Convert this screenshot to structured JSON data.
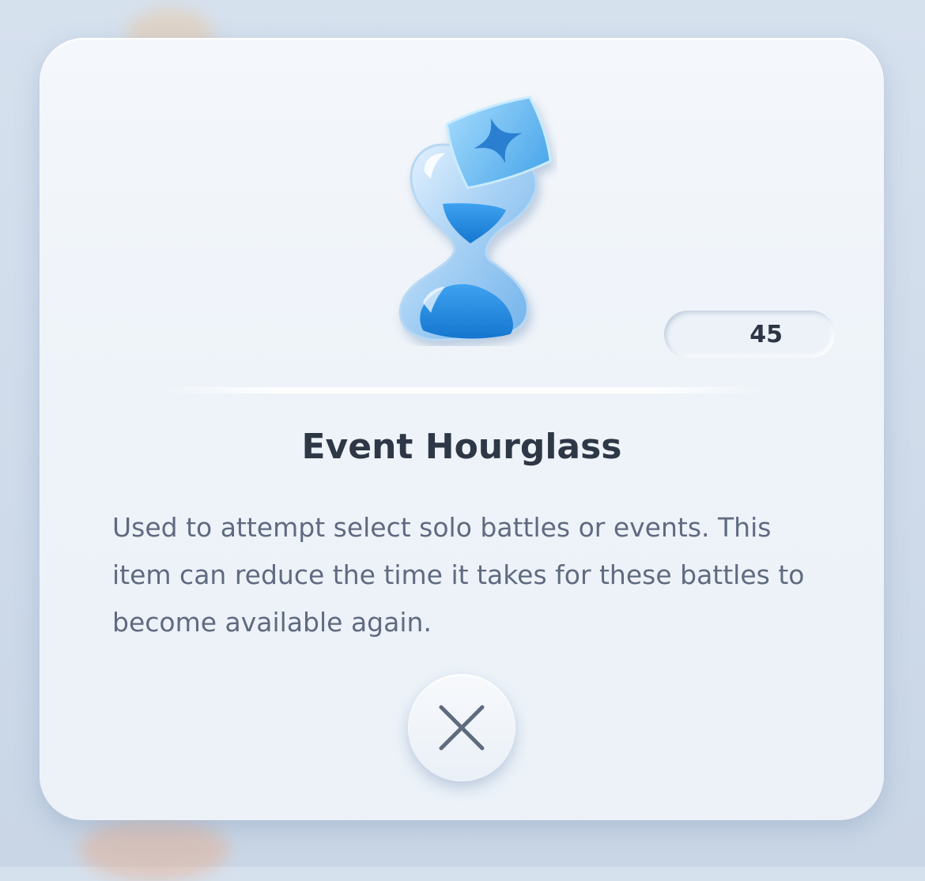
{
  "item": {
    "name": "Event Hourglass",
    "count": "45",
    "description": "Used to attempt select solo battles or events. This item can reduce the time it takes for these battles to become available again.",
    "icon": "event-hourglass-icon"
  },
  "dialog": {
    "close_icon": "close-icon"
  },
  "colors": {
    "title": "#2e3746",
    "description": "#606a80",
    "accent_blue": "#2e8fe6",
    "panel": "#eef3f9"
  }
}
